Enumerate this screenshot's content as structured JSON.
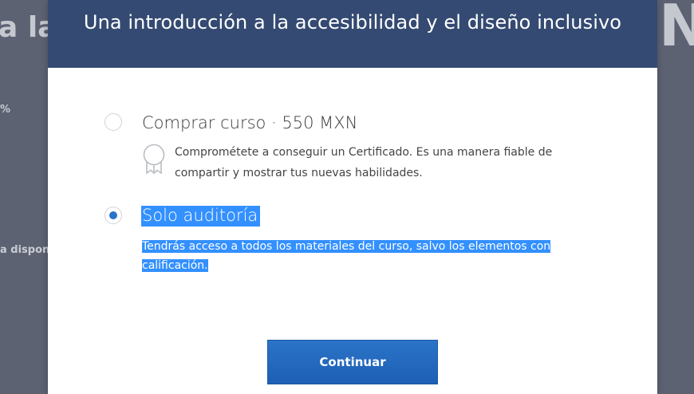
{
  "background": {
    "title_left_fragment": "a la",
    "title_right_fragment": "N",
    "percent_fragment": "%",
    "availability_fragment": "a disponi"
  },
  "modal": {
    "title": "Una introducción a la accesibilidad y el diseño inclusivo",
    "options": [
      {
        "label": "Comprar curso · 550 MXN",
        "description_line1": "Comprométete a conseguir un Certificado. Es una manera fiable de",
        "description_line2": "compartir y mostrar tus nuevas habilidades.",
        "selected": false,
        "icon": "certificate-icon"
      },
      {
        "label": "Solo auditoría",
        "description_line1": "Tendrás acceso a todos los materiales del curso, salvo los elementos con",
        "description_line2": "calificación.",
        "selected": true
      }
    ],
    "continue_label": "Continuar"
  },
  "colors": {
    "header_bg": "#344a72",
    "accent": "#2a73cc",
    "selection_highlight": "#3390ff",
    "overlay": "#5c6272"
  }
}
